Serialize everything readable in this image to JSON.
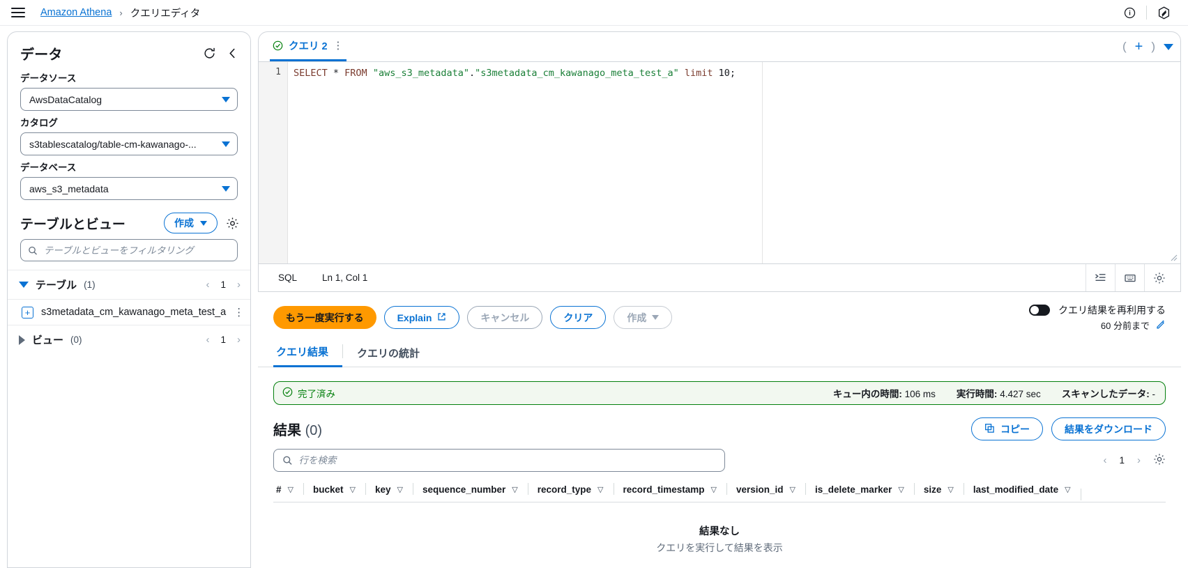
{
  "topbar": {
    "menu_icon": "hamburger-icon",
    "breadcrumb_root": "Amazon Athena",
    "breadcrumb_sep": "›",
    "breadcrumb_current": "クエリエディタ",
    "info_icon": "info-icon",
    "settings_icon": "aws-settings-icon"
  },
  "sidebar": {
    "title": "データ",
    "refresh_icon": "refresh-icon",
    "collapse_icon": "chevron-left-icon",
    "data_source_label": "データソース",
    "data_source_value": "AwsDataCatalog",
    "catalog_label": "カタログ",
    "catalog_value": "s3tablescatalog/table-cm-kawanago-...",
    "database_label": "データベース",
    "database_value": "aws_s3_metadata",
    "tables_views_title": "テーブルとビュー",
    "create_label": "作成",
    "gear_icon": "gear-icon",
    "filter_placeholder": "テーブルとビューをフィルタリング",
    "sections": [
      {
        "name": "テーブル",
        "count": "(1)",
        "page": "1",
        "expanded": true
      },
      {
        "name": "ビュー",
        "count": "(0)",
        "page": "1",
        "expanded": false
      }
    ],
    "table_item": "s3metadata_cm_kawanago_meta_test_a"
  },
  "editor": {
    "tab_label": "クエリ 2",
    "tab_status_icon": "check-circle-icon",
    "tab_menu_icon": "kebab-icon",
    "add_tab_icon": "plus-icon",
    "tab_dropdown_icon": "caret-down-icon",
    "line_number": "1",
    "sql_parts": {
      "select": "SELECT",
      "star": " * ",
      "from": "FROM",
      "schema": " \"aws_s3_metadata\"",
      "dot": ".",
      "table": "\"s3metadata_cm_kawanago_meta_test_a\"",
      "limit": " limit ",
      "num": "10",
      "semi": ";"
    },
    "language": "SQL",
    "cursor": "Ln 1, Col 1",
    "format_icon": "format-icon",
    "keyboard_icon": "keyboard-icon",
    "settings_icon": "gear-icon"
  },
  "actions": {
    "run_again": "もう一度実行する",
    "explain": "Explain",
    "explain_ext_icon": "external-link-icon",
    "cancel": "キャンセル",
    "clear": "クリア",
    "create": "作成",
    "reuse_label": "クエリ結果を再利用する",
    "reuse_sub": "60 分前まで",
    "edit_icon": "pencil-icon"
  },
  "result_tabs": [
    {
      "label": "クエリ結果",
      "active": true
    },
    {
      "label": "クエリの統計",
      "active": false
    }
  ],
  "status": {
    "state_icon": "check-circle-icon",
    "state": "完了済み",
    "queue_label": "キュー内の時間:",
    "queue_value": "106 ms",
    "runtime_label": "実行時間:",
    "runtime_value": "4.427 sec",
    "scanned_label": "スキャンしたデータ:",
    "scanned_value": "-"
  },
  "results": {
    "title": "結果",
    "count": "(0)",
    "copy_label": "コピー",
    "copy_icon": "copy-icon",
    "download_label": "結果をダウンロード",
    "search_placeholder": "行を検索",
    "search_icon": "search-icon",
    "page": "1",
    "prev_icon": "chevron-left-icon",
    "next_icon": "chevron-right-icon",
    "settings_icon": "gear-icon",
    "columns": [
      "#",
      "bucket",
      "key",
      "sequence_number",
      "record_type",
      "record_timestamp",
      "version_id",
      "is_delete_marker",
      "size",
      "last_modified_date"
    ],
    "sort_glyph": "▽",
    "empty_title": "結果なし",
    "empty_sub": "クエリを実行して結果を表示"
  },
  "colors": {
    "link": "#0972d3",
    "primary": "#ff9900",
    "success": "#037f0c",
    "success_bg": "#f2f8f0"
  }
}
